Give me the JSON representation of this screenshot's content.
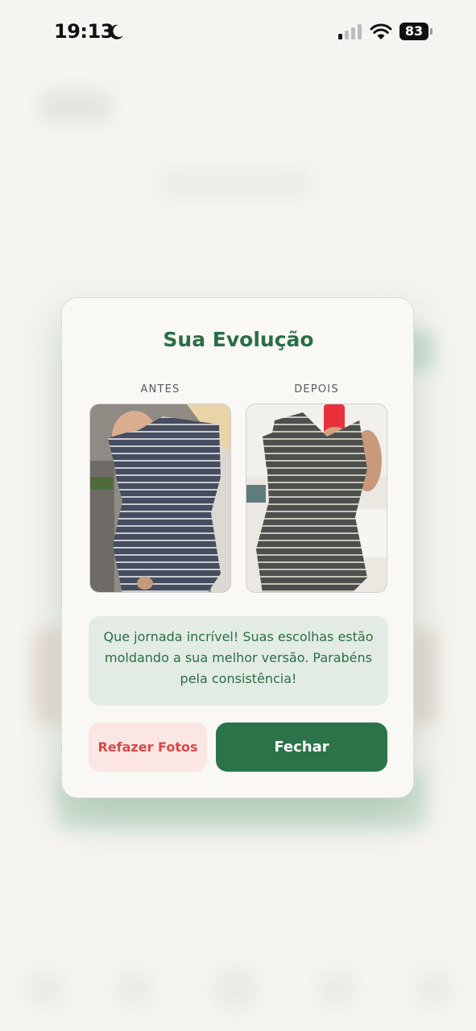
{
  "status_bar": {
    "time": "19:13",
    "battery_level": "83",
    "icons": [
      "moon-icon",
      "cellular-signal-icon",
      "wifi-icon",
      "battery-icon"
    ]
  },
  "modal": {
    "title": "Sua Evolução",
    "before_label": "ANTES",
    "after_label": "DEPOIS",
    "message": "Que jornada incrível! Suas escolhas estão moldando a sua melhor versão. Parabéns pela consistência!",
    "retake_button": "Refazer Fotos",
    "close_button": "Fechar"
  },
  "colors": {
    "brand_green": "#2a6e45",
    "button_green": "#2b7449",
    "danger_red": "#d94848",
    "danger_bg": "#fbe6e4",
    "message_bg": "#e3ece4",
    "background": "#f5f4f0"
  }
}
